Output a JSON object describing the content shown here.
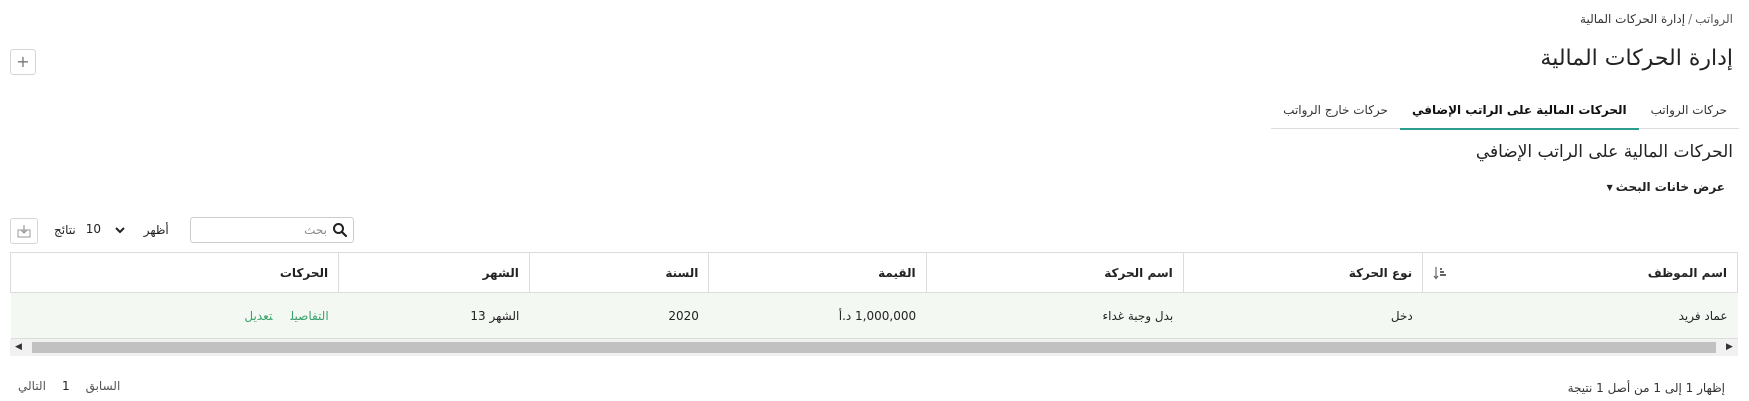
{
  "breadcrumb": {
    "root": "الرواتب",
    "separator": "/",
    "current": "إدارة الحركات المالية"
  },
  "page_title": "إدارة الحركات المالية",
  "add_button": "+",
  "tabs": [
    {
      "label": "حركات الرواتب",
      "active": false
    },
    {
      "label": "الحركات المالية على الراتب الإضافي",
      "active": true
    },
    {
      "label": "حركات خارج الرواتب",
      "active": false
    }
  ],
  "section_title": "الحركات المالية على الراتب الإضافي",
  "search_toggle": "عرض خانات البحث",
  "search": {
    "placeholder": "بحث",
    "icon": "search-icon"
  },
  "length": {
    "show": "أظهر",
    "value": "10",
    "suffix": "نتائج"
  },
  "table": {
    "headers": [
      "اسم الموظف",
      "نوع الحركة",
      "اسم الحركة",
      "القيمة",
      "السنة",
      "الشهر",
      "الحركات"
    ],
    "rows": [
      {
        "employee": "عماد فريد",
        "type": "دخل",
        "name": "بدل وجبة غداء",
        "value": "1,000,000 د.أ",
        "year": "2020",
        "month": "الشهر 13",
        "actions": [
          "التفاصيل",
          "تعديل"
        ]
      }
    ]
  },
  "info": "إظهار 1 إلى 1 من أصل 1 نتيجة",
  "pagination": {
    "prev": "السابق",
    "current": "1",
    "next": "التالي"
  },
  "colors": {
    "accent": "#2a9d8f",
    "link": "#3aa06b",
    "row_bg": "#f3f8f3"
  }
}
